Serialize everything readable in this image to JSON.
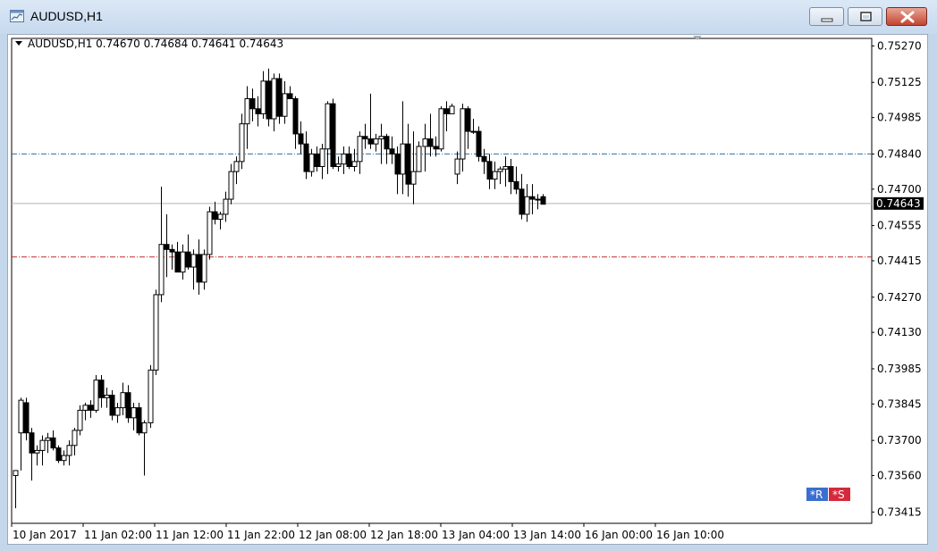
{
  "window": {
    "title": "AUDUSD,H1"
  },
  "chart_header": {
    "label": "AUDUSD,H1  0.74670 0.74684 0.74641 0.74643"
  },
  "current_price": "0.74643",
  "markers": {
    "r_label": "*R",
    "s_label": "*S"
  },
  "colors": {
    "candle_border": "#000000",
    "bull_body": "#ffffff",
    "bear_body": "#000000",
    "resistance_line": "#2e6f9e",
    "support_line": "#c0282d",
    "bid_line": "#b4b4b4",
    "r_badge": "#3a6fd0",
    "s_badge": "#d42a3c"
  },
  "chart_data": {
    "type": "candlestick",
    "title": "AUDUSD,H1",
    "ylim": [
      0.7337,
      0.753
    ],
    "yticks": [
      "0.75270",
      "0.75125",
      "0.74985",
      "0.74840",
      "0.74700",
      "0.74555",
      "0.74415",
      "0.74270",
      "0.74130",
      "0.73985",
      "0.73845",
      "0.73700",
      "0.73560",
      "0.73415"
    ],
    "xticks": [
      "10 Jan 2017",
      "11 Jan 02:00",
      "11 Jan 12:00",
      "11 Jan 22:00",
      "12 Jan 08:00",
      "12 Jan 18:00",
      "13 Jan 04:00",
      "13 Jan 14:00",
      "16 Jan 00:00",
      "16 Jan 10:00"
    ],
    "hlines": {
      "resistance": 0.7484,
      "support": 0.7443,
      "bid": 0.74643
    },
    "candles": [
      [
        0.7356,
        0.7358,
        0.7343,
        0.7358
      ],
      [
        0.7373,
        0.7387,
        0.7358,
        0.7386
      ],
      [
        0.7385,
        0.7387,
        0.737,
        0.7373
      ],
      [
        0.7373,
        0.7375,
        0.7354,
        0.7365
      ],
      [
        0.7365,
        0.7368,
        0.736,
        0.7366
      ],
      [
        0.7366,
        0.7372,
        0.736,
        0.737
      ],
      [
        0.737,
        0.7373,
        0.7365,
        0.7371
      ],
      [
        0.7371,
        0.7374,
        0.7366,
        0.7367
      ],
      [
        0.7367,
        0.7368,
        0.7361,
        0.7362
      ],
      [
        0.7362,
        0.7366,
        0.736,
        0.7364
      ],
      [
        0.7364,
        0.737,
        0.736,
        0.7368
      ],
      [
        0.7368,
        0.7375,
        0.7364,
        0.7374
      ],
      [
        0.7374,
        0.7384,
        0.7372,
        0.7382
      ],
      [
        0.7382,
        0.7385,
        0.7378,
        0.7384
      ],
      [
        0.7384,
        0.7386,
        0.7379,
        0.7382
      ],
      [
        0.7382,
        0.7396,
        0.7381,
        0.7394
      ],
      [
        0.7394,
        0.7396,
        0.7383,
        0.7387
      ],
      [
        0.7387,
        0.7391,
        0.7383,
        0.7388
      ],
      [
        0.7388,
        0.739,
        0.7378,
        0.738
      ],
      [
        0.738,
        0.7385,
        0.7377,
        0.7383
      ],
      [
        0.7383,
        0.7393,
        0.738,
        0.7389
      ],
      [
        0.7389,
        0.7392,
        0.7377,
        0.7379
      ],
      [
        0.7379,
        0.7385,
        0.7374,
        0.7383
      ],
      [
        0.7383,
        0.7385,
        0.7372,
        0.7373
      ],
      [
        0.7373,
        0.7378,
        0.7356,
        0.7377
      ],
      [
        0.7377,
        0.74,
        0.7375,
        0.7398
      ],
      [
        0.7398,
        0.743,
        0.7396,
        0.7428
      ],
      [
        0.7428,
        0.7471,
        0.7425,
        0.7448
      ],
      [
        0.7448,
        0.746,
        0.7435,
        0.7446
      ],
      [
        0.7446,
        0.7448,
        0.7438,
        0.7445
      ],
      [
        0.7445,
        0.7449,
        0.7437,
        0.7437
      ],
      [
        0.7437,
        0.7448,
        0.7434,
        0.7445
      ],
      [
        0.7445,
        0.7452,
        0.7438,
        0.7439
      ],
      [
        0.7439,
        0.7446,
        0.743,
        0.7444
      ],
      [
        0.7444,
        0.745,
        0.7428,
        0.7433
      ],
      [
        0.7433,
        0.7446,
        0.743,
        0.7444
      ],
      [
        0.7444,
        0.7463,
        0.7442,
        0.7461
      ],
      [
        0.7461,
        0.7465,
        0.7456,
        0.7458
      ],
      [
        0.7458,
        0.7461,
        0.7454,
        0.746
      ],
      [
        0.746,
        0.7469,
        0.7457,
        0.7466
      ],
      [
        0.7466,
        0.748,
        0.7464,
        0.7477
      ],
      [
        0.7477,
        0.7483,
        0.7472,
        0.7481
      ],
      [
        0.7481,
        0.75,
        0.7478,
        0.7496
      ],
      [
        0.7496,
        0.7511,
        0.7486,
        0.7506
      ],
      [
        0.7506,
        0.751,
        0.7497,
        0.7502
      ],
      [
        0.7502,
        0.7507,
        0.7495,
        0.75
      ],
      [
        0.75,
        0.7517,
        0.7498,
        0.7513
      ],
      [
        0.7513,
        0.7518,
        0.7495,
        0.7498
      ],
      [
        0.7498,
        0.7516,
        0.7493,
        0.7514
      ],
      [
        0.7514,
        0.7516,
        0.7496,
        0.7499
      ],
      [
        0.7499,
        0.7513,
        0.7496,
        0.7508
      ],
      [
        0.7508,
        0.7511,
        0.7506,
        0.7506
      ],
      [
        0.7506,
        0.7507,
        0.7486,
        0.7492
      ],
      [
        0.7492,
        0.7497,
        0.7484,
        0.7488
      ],
      [
        0.7488,
        0.7493,
        0.7474,
        0.7477
      ],
      [
        0.7477,
        0.7486,
        0.7475,
        0.7484
      ],
      [
        0.7484,
        0.7487,
        0.7477,
        0.7479
      ],
      [
        0.7479,
        0.7488,
        0.7474,
        0.7486
      ],
      [
        0.7486,
        0.7505,
        0.7476,
        0.7504
      ],
      [
        0.7504,
        0.7506,
        0.7478,
        0.7479
      ],
      [
        0.7479,
        0.7483,
        0.7477,
        0.748
      ],
      [
        0.748,
        0.7487,
        0.7476,
        0.7484
      ],
      [
        0.7484,
        0.7487,
        0.7478,
        0.7479
      ],
      [
        0.7479,
        0.7486,
        0.7477,
        0.7481
      ],
      [
        0.7481,
        0.7493,
        0.7476,
        0.7491
      ],
      [
        0.7491,
        0.7496,
        0.7486,
        0.749
      ],
      [
        0.749,
        0.7508,
        0.7486,
        0.7488
      ],
      [
        0.7488,
        0.7492,
        0.7485,
        0.749
      ],
      [
        0.749,
        0.7496,
        0.748,
        0.7491
      ],
      [
        0.7491,
        0.7492,
        0.748,
        0.7486
      ],
      [
        0.7486,
        0.7491,
        0.748,
        0.7484
      ],
      [
        0.7484,
        0.7487,
        0.7468,
        0.7476
      ],
      [
        0.7476,
        0.7505,
        0.7468,
        0.7488
      ],
      [
        0.7488,
        0.7496,
        0.7467,
        0.7472
      ],
      [
        0.7472,
        0.7493,
        0.7464,
        0.7477
      ],
      [
        0.7477,
        0.7489,
        0.748,
        0.7487
      ],
      [
        0.7487,
        0.7496,
        0.7477,
        0.749
      ],
      [
        0.749,
        0.75,
        0.7483,
        0.7487
      ],
      [
        0.7487,
        0.7491,
        0.7483,
        0.7486
      ],
      [
        0.7486,
        0.7503,
        0.7485,
        0.7502
      ],
      [
        0.7502,
        0.7505,
        0.7493,
        0.75
      ],
      [
        0.75,
        0.7504,
        0.75,
        0.7503
      ],
      [
        0.7476,
        0.7485,
        0.7472,
        0.7482
      ],
      [
        0.7482,
        0.7504,
        0.7477,
        0.7502
      ],
      [
        0.7502,
        0.7503,
        0.7486,
        0.7493
      ],
      [
        0.7493,
        0.7498,
        0.7492,
        0.7493
      ],
      [
        0.7493,
        0.7495,
        0.7481,
        0.7483
      ],
      [
        0.7483,
        0.7486,
        0.7476,
        0.7481
      ],
      [
        0.7481,
        0.7484,
        0.747,
        0.7474
      ],
      [
        0.7474,
        0.7481,
        0.747,
        0.7477
      ],
      [
        0.7477,
        0.7479,
        0.7472,
        0.7478
      ],
      [
        0.7478,
        0.7483,
        0.7471,
        0.7479
      ],
      [
        0.7479,
        0.7482,
        0.7468,
        0.7473
      ],
      [
        0.7473,
        0.7479,
        0.7468,
        0.747
      ],
      [
        0.747,
        0.7476,
        0.7458,
        0.746
      ],
      [
        0.746,
        0.7472,
        0.7457,
        0.7467
      ],
      [
        0.7467,
        0.7472,
        0.746,
        0.7466
      ],
      [
        0.7466,
        0.7468,
        0.7462,
        0.7466
      ],
      [
        0.7467,
        0.7468,
        0.7464,
        0.7464
      ]
    ]
  }
}
